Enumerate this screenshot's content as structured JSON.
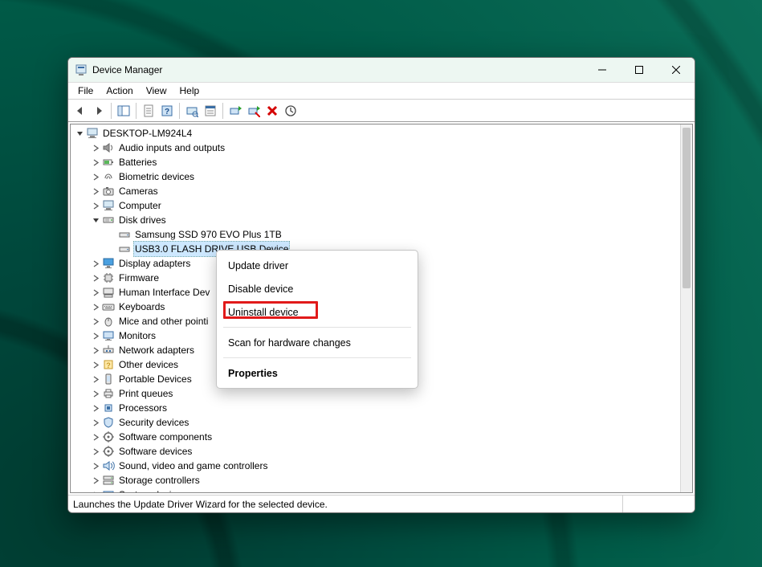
{
  "window": {
    "title": "Device Manager"
  },
  "menu": {
    "file": "File",
    "action": "Action",
    "view": "View",
    "help": "Help"
  },
  "tree": {
    "root": "DESKTOP-LM924L4",
    "categories": [
      {
        "label": "Audio inputs and outputs",
        "expanded": false
      },
      {
        "label": "Batteries",
        "expanded": false
      },
      {
        "label": "Biometric devices",
        "expanded": false
      },
      {
        "label": "Cameras",
        "expanded": false
      },
      {
        "label": "Computer",
        "expanded": false
      },
      {
        "label": "Disk drives",
        "expanded": true,
        "children": [
          {
            "label": "Samsung SSD 970 EVO Plus 1TB"
          },
          {
            "label": "USB3.0 FLASH DRIVE USB Device",
            "selected": true
          }
        ]
      },
      {
        "label": "Display adapters",
        "expanded": false
      },
      {
        "label": "Firmware",
        "expanded": false
      },
      {
        "label": "Human Interface Dev",
        "expanded": false,
        "truncated": true
      },
      {
        "label": "Keyboards",
        "expanded": false
      },
      {
        "label": "Mice and other pointi",
        "expanded": false,
        "truncated": true
      },
      {
        "label": "Monitors",
        "expanded": false
      },
      {
        "label": "Network adapters",
        "expanded": false
      },
      {
        "label": "Other devices",
        "expanded": false
      },
      {
        "label": "Portable Devices",
        "expanded": false
      },
      {
        "label": "Print queues",
        "expanded": false
      },
      {
        "label": "Processors",
        "expanded": false
      },
      {
        "label": "Security devices",
        "expanded": false
      },
      {
        "label": "Software components",
        "expanded": false
      },
      {
        "label": "Software devices",
        "expanded": false
      },
      {
        "label": "Sound, video and game controllers",
        "expanded": false
      },
      {
        "label": "Storage controllers",
        "expanded": false
      },
      {
        "label": "System devices",
        "expanded": false,
        "cutoff": true
      }
    ]
  },
  "context_menu": {
    "update": "Update driver",
    "disable": "Disable device",
    "uninstall": "Uninstall device",
    "scan": "Scan for hardware changes",
    "properties": "Properties"
  },
  "statusbar": {
    "text": "Launches the Update Driver Wizard for the selected device."
  }
}
